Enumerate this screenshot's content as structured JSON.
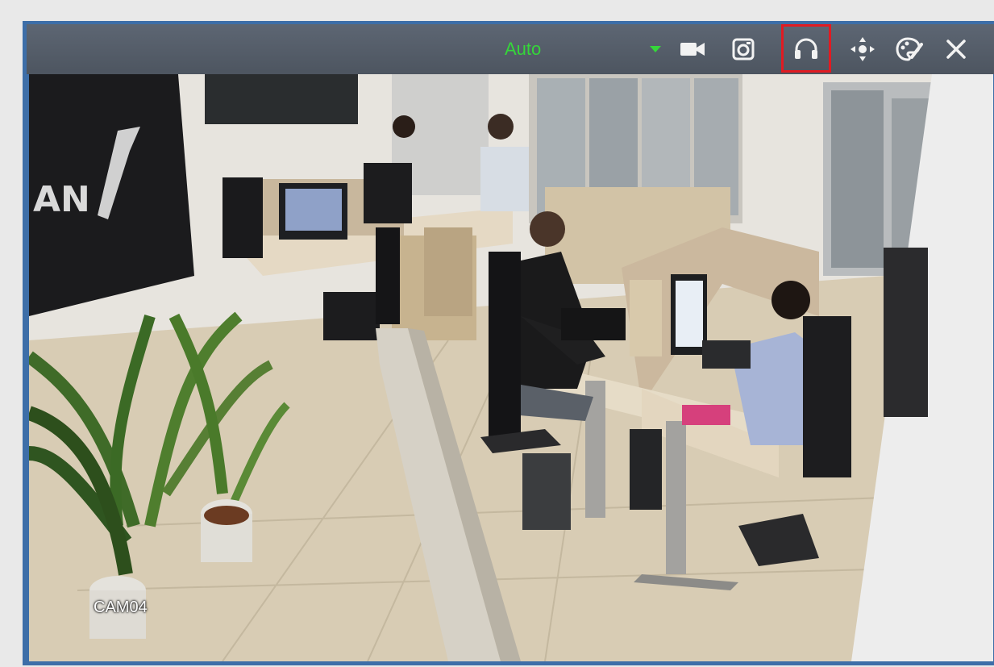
{
  "toolbar": {
    "stream_mode": "Auto",
    "buttons": [
      {
        "name": "record-icon"
      },
      {
        "name": "snapshot-icon"
      },
      {
        "name": "audio-headphones-icon",
        "highlighted": true
      },
      {
        "name": "ptz-move-icon"
      },
      {
        "name": "image-settings-icon"
      },
      {
        "name": "close-icon"
      }
    ],
    "highlight_color": "#e11b22",
    "accent_color": "#35d63a"
  },
  "video": {
    "camera_label": "CAM04",
    "wall_logo_text": "AN"
  }
}
